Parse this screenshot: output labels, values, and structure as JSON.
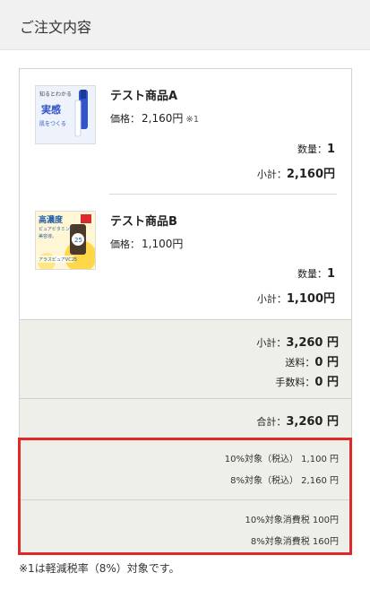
{
  "header": {
    "title": "ご注文内容"
  },
  "items": [
    {
      "name": "テスト商品A",
      "price_label": "価格：",
      "price": "2,160円",
      "price_note": "※1",
      "qty_label": "数量：",
      "qty": "1",
      "subtotal_label": "小計：",
      "subtotal": "2,160円",
      "thumb_text": [
        "知るとわかる",
        "実感",
        "肌をつくる"
      ]
    },
    {
      "name": "テスト商品B",
      "price_label": "価格：",
      "price": "1,100円",
      "qty_label": "数量：",
      "qty": "1",
      "subtotal_label": "小計：",
      "subtotal": "1,100円",
      "thumb_text": [
        "高濃度",
        "ピュアビタミンC",
        "美容液。",
        "アラスピュアVC25",
        "25"
      ]
    }
  ],
  "summary": {
    "subtotal_label": "小計：",
    "subtotal": "3,260 円",
    "shipping_label": "送料：",
    "shipping": "0 円",
    "fee_label": "手数料：",
    "fee": "0 円"
  },
  "total": {
    "label": "合計：",
    "value": "3,260 円"
  },
  "tax": {
    "rows": [
      "10%対象（税込） 1,100 円",
      "8%対象（税込） 2,160 円",
      "10%対象消費税 100円",
      "8%対象消費税 160円"
    ]
  },
  "footnote": "※1は軽減税率（8%）対象です。",
  "colors": {
    "highlight": "#e02828",
    "summary_bg": "#efefea",
    "header_bg": "#f1f1f1"
  }
}
